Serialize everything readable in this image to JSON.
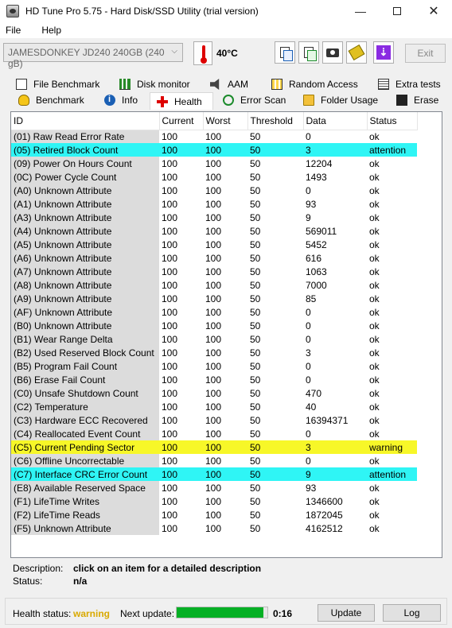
{
  "window": {
    "title": "HD Tune Pro 5.75 - Hard Disk/SSD Utility (trial version)",
    "min_glyph": "—",
    "close_glyph": "✕"
  },
  "menu": {
    "items": [
      "File",
      "Help"
    ]
  },
  "toolbar": {
    "drive": "JAMESDONKEY JD240 240GB (240 gB)",
    "temperature": "40°C",
    "exit_label": "Exit"
  },
  "tabs": {
    "row1": [
      "File Benchmark",
      "Disk monitor",
      "AAM",
      "Random Access",
      "Extra tests"
    ],
    "row2": [
      "Benchmark",
      "Info",
      "Health",
      "Error Scan",
      "Folder Usage",
      "Erase"
    ],
    "active": "Health"
  },
  "table": {
    "headers": [
      "ID",
      "Current",
      "Worst",
      "Threshold",
      "Data",
      "Status"
    ],
    "rows": [
      {
        "id": "(01) Raw Read Error Rate",
        "current": "100",
        "worst": "100",
        "threshold": "50",
        "data": "0",
        "status": "ok"
      },
      {
        "id": "(05) Retired Block Count",
        "current": "100",
        "worst": "100",
        "threshold": "50",
        "data": "3",
        "status": "attention"
      },
      {
        "id": "(09) Power On Hours Count",
        "current": "100",
        "worst": "100",
        "threshold": "50",
        "data": "12204",
        "status": "ok"
      },
      {
        "id": "(0C) Power Cycle Count",
        "current": "100",
        "worst": "100",
        "threshold": "50",
        "data": "1493",
        "status": "ok"
      },
      {
        "id": "(A0) Unknown Attribute",
        "current": "100",
        "worst": "100",
        "threshold": "50",
        "data": "0",
        "status": "ok"
      },
      {
        "id": "(A1) Unknown Attribute",
        "current": "100",
        "worst": "100",
        "threshold": "50",
        "data": "93",
        "status": "ok"
      },
      {
        "id": "(A3) Unknown Attribute",
        "current": "100",
        "worst": "100",
        "threshold": "50",
        "data": "9",
        "status": "ok"
      },
      {
        "id": "(A4) Unknown Attribute",
        "current": "100",
        "worst": "100",
        "threshold": "50",
        "data": "569011",
        "status": "ok"
      },
      {
        "id": "(A5) Unknown Attribute",
        "current": "100",
        "worst": "100",
        "threshold": "50",
        "data": "5452",
        "status": "ok"
      },
      {
        "id": "(A6) Unknown Attribute",
        "current": "100",
        "worst": "100",
        "threshold": "50",
        "data": "616",
        "status": "ok"
      },
      {
        "id": "(A7) Unknown Attribute",
        "current": "100",
        "worst": "100",
        "threshold": "50",
        "data": "1063",
        "status": "ok"
      },
      {
        "id": "(A8) Unknown Attribute",
        "current": "100",
        "worst": "100",
        "threshold": "50",
        "data": "7000",
        "status": "ok"
      },
      {
        "id": "(A9) Unknown Attribute",
        "current": "100",
        "worst": "100",
        "threshold": "50",
        "data": "85",
        "status": "ok"
      },
      {
        "id": "(AF) Unknown Attribute",
        "current": "100",
        "worst": "100",
        "threshold": "50",
        "data": "0",
        "status": "ok"
      },
      {
        "id": "(B0) Unknown Attribute",
        "current": "100",
        "worst": "100",
        "threshold": "50",
        "data": "0",
        "status": "ok"
      },
      {
        "id": "(B1) Wear Range Delta",
        "current": "100",
        "worst": "100",
        "threshold": "50",
        "data": "0",
        "status": "ok"
      },
      {
        "id": "(B2) Used Reserved Block Count",
        "current": "100",
        "worst": "100",
        "threshold": "50",
        "data": "3",
        "status": "ok"
      },
      {
        "id": "(B5) Program Fail Count",
        "current": "100",
        "worst": "100",
        "threshold": "50",
        "data": "0",
        "status": "ok"
      },
      {
        "id": "(B6) Erase Fail Count",
        "current": "100",
        "worst": "100",
        "threshold": "50",
        "data": "0",
        "status": "ok"
      },
      {
        "id": "(C0) Unsafe Shutdown Count",
        "current": "100",
        "worst": "100",
        "threshold": "50",
        "data": "470",
        "status": "ok"
      },
      {
        "id": "(C2) Temperature",
        "current": "100",
        "worst": "100",
        "threshold": "50",
        "data": "40",
        "status": "ok"
      },
      {
        "id": "(C3) Hardware ECC Recovered",
        "current": "100",
        "worst": "100",
        "threshold": "50",
        "data": "16394371",
        "status": "ok"
      },
      {
        "id": "(C4) Reallocated Event Count",
        "current": "100",
        "worst": "100",
        "threshold": "50",
        "data": "0",
        "status": "ok"
      },
      {
        "id": "(C5) Current Pending Sector",
        "current": "100",
        "worst": "100",
        "threshold": "50",
        "data": "3",
        "status": "warning"
      },
      {
        "id": "(C6) Offline Uncorrectable",
        "current": "100",
        "worst": "100",
        "threshold": "50",
        "data": "0",
        "status": "ok"
      },
      {
        "id": "(C7) Interface CRC Error Count",
        "current": "100",
        "worst": "100",
        "threshold": "50",
        "data": "9",
        "status": "attention"
      },
      {
        "id": "(E8) Available Reserved Space",
        "current": "100",
        "worst": "100",
        "threshold": "50",
        "data": "93",
        "status": "ok"
      },
      {
        "id": "(F1) LifeTime Writes",
        "current": "100",
        "worst": "100",
        "threshold": "50",
        "data": "1346600",
        "status": "ok"
      },
      {
        "id": "(F2) LifeTime Reads",
        "current": "100",
        "worst": "100",
        "threshold": "50",
        "data": "1872045",
        "status": "ok"
      },
      {
        "id": "(F5) Unknown Attribute",
        "current": "100",
        "worst": "100",
        "threshold": "50",
        "data": "4162512",
        "status": "ok"
      }
    ]
  },
  "colors": {
    "attention": "#2ff5f5",
    "warning": "#f7f728",
    "health_warning_text": "#d9a900",
    "progress": "#06b025"
  },
  "description": {
    "description_label": "Description:",
    "description_value": "click on an item for a detailed description",
    "status_label": "Status:",
    "status_value": "n/a"
  },
  "footer": {
    "health_status_label": "Health status:",
    "health_status_value": "warning",
    "next_update_label": "Next update:",
    "progress_fraction": 0.96,
    "time": "0:16",
    "update_label": "Update",
    "log_label": "Log"
  }
}
